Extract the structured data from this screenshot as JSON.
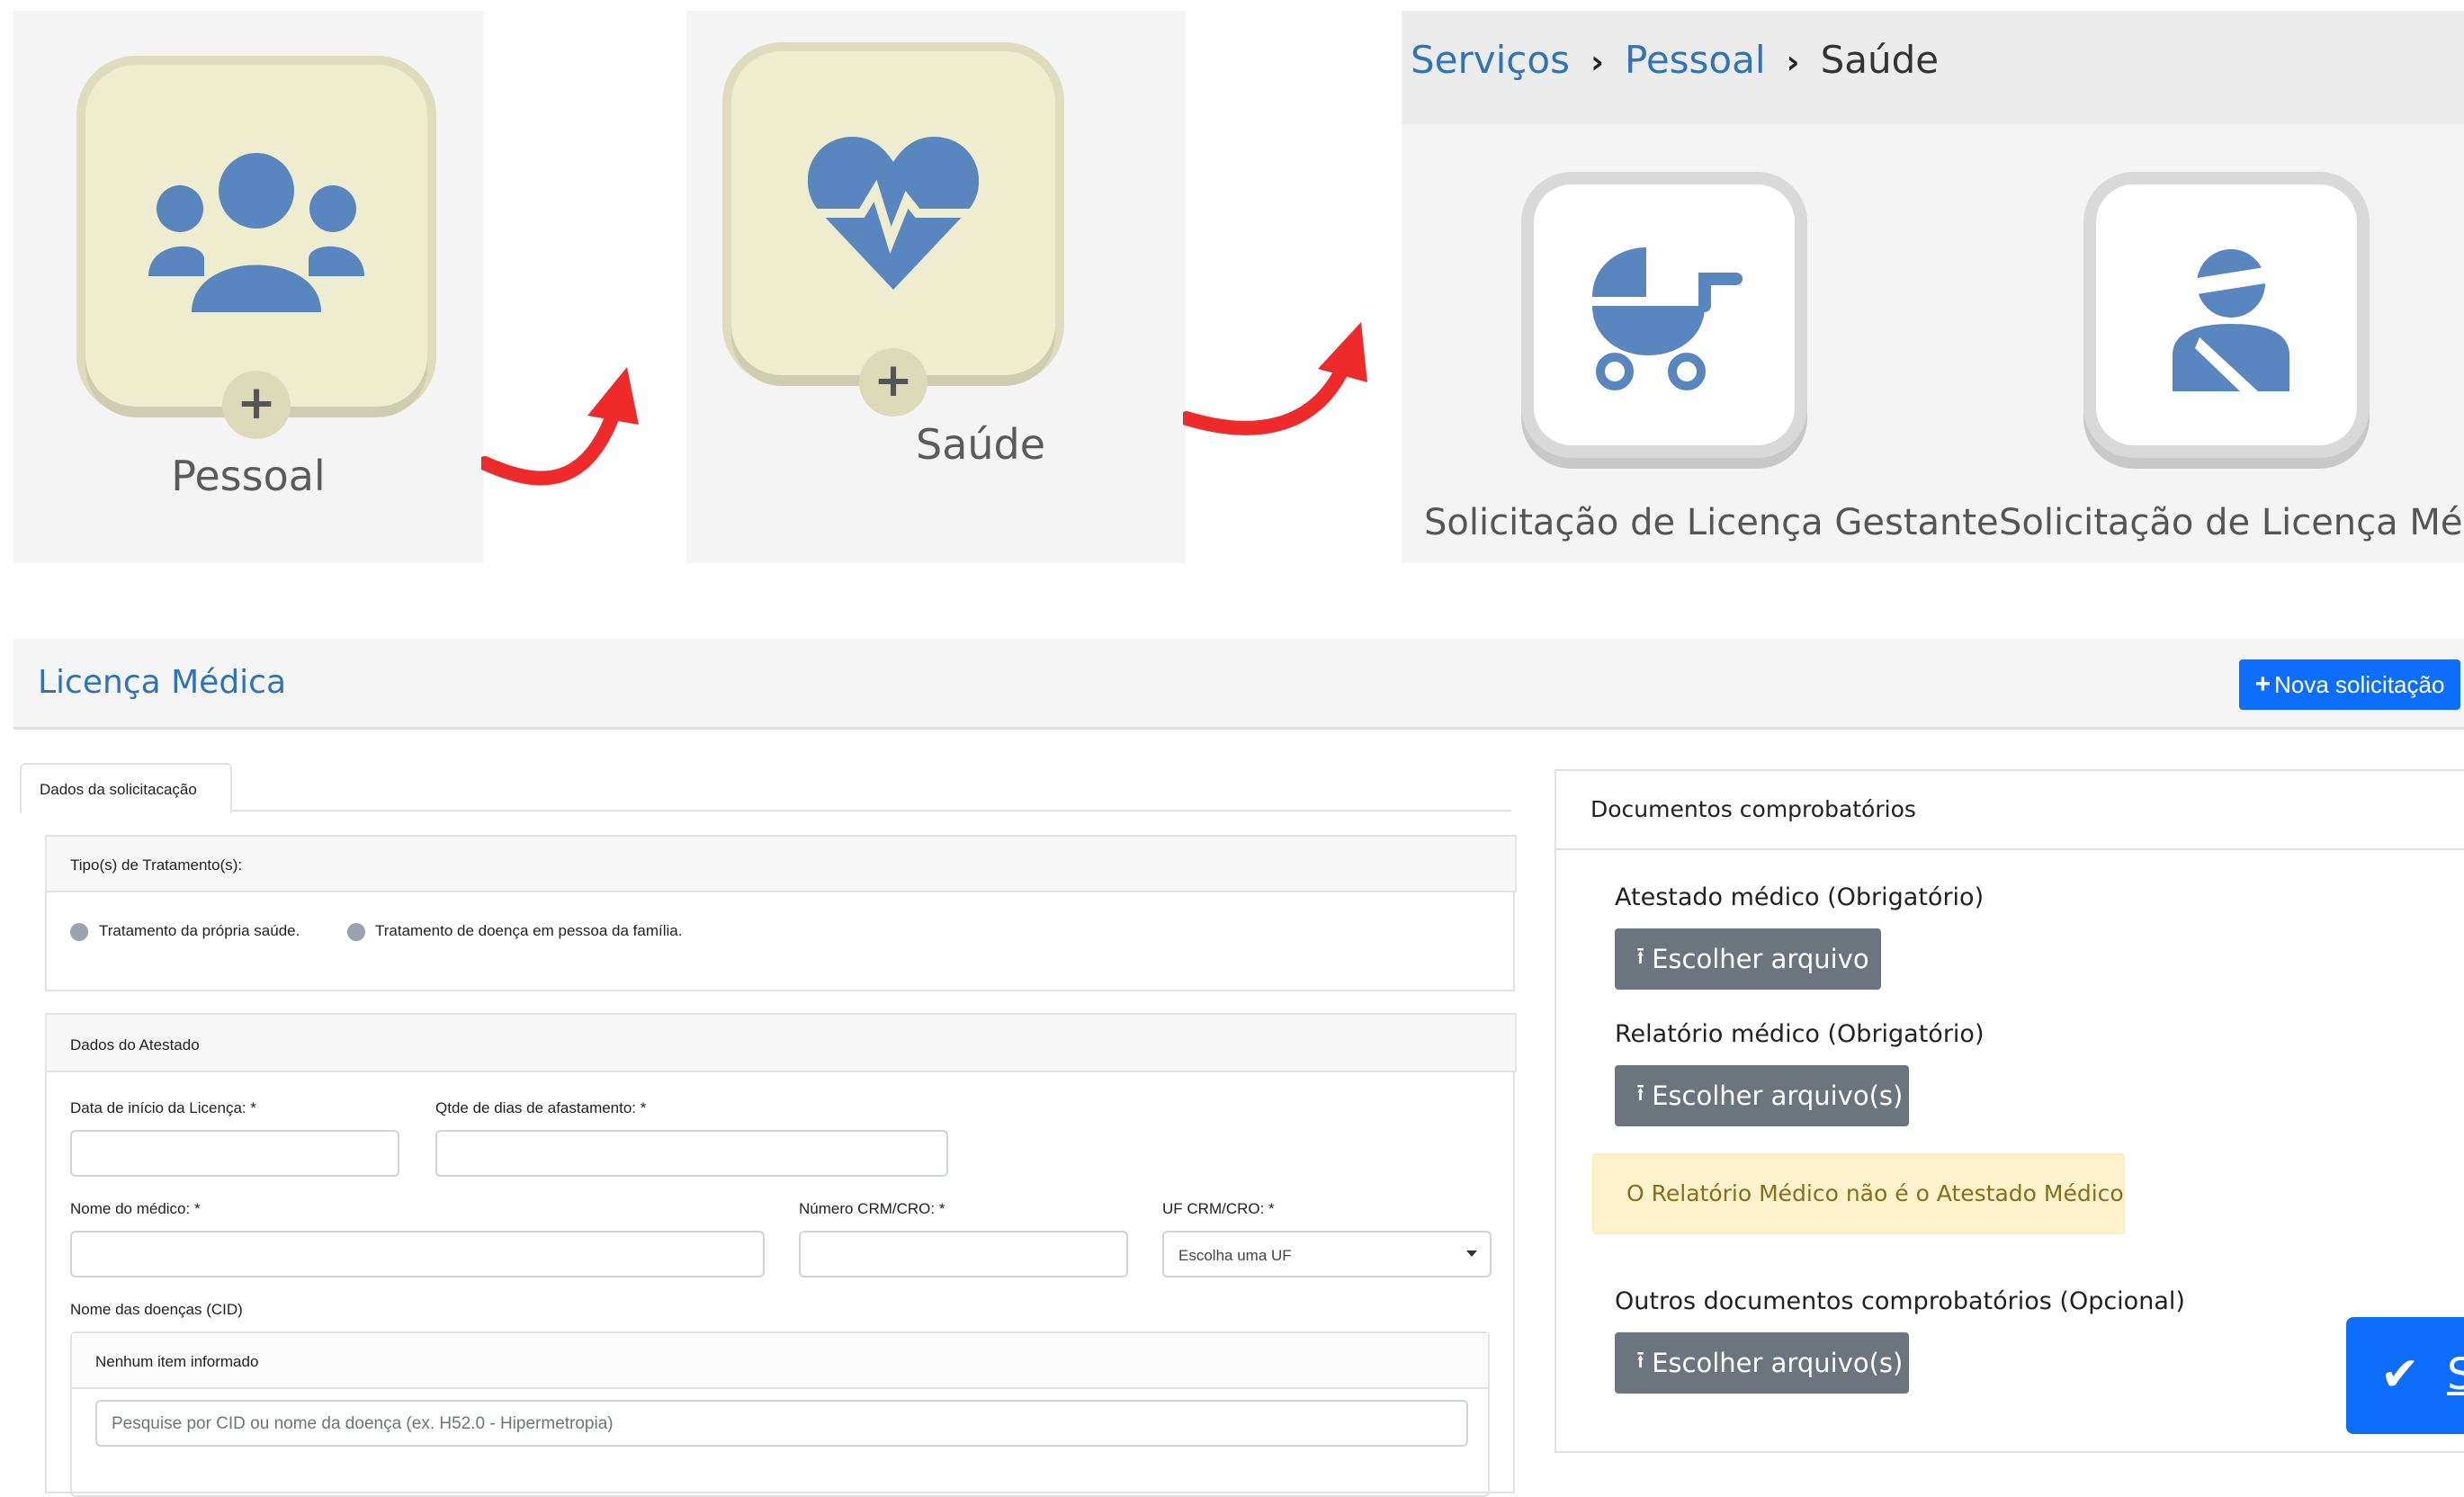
{
  "steps": {
    "pessoal": {
      "label": "Pessoal",
      "plus": "+"
    },
    "saude": {
      "label": "Saúde",
      "plus": "+"
    }
  },
  "breadcrumb": {
    "items": [
      "Serviços",
      "Pessoal",
      "Saúde"
    ],
    "separator": "›"
  },
  "services": [
    {
      "label": "Solicitação de Licença Gestante",
      "icon": "baby-carriage-icon"
    },
    {
      "label": "Solicitação de Licença Médica",
      "icon": "injured-person-icon"
    }
  ],
  "colors": {
    "icon_blue": "#5a86c0",
    "link_blue": "#2f73b8",
    "primary": "#0d6efd",
    "arrow_red": "#ef2a2a",
    "tile_bg": "#efedcf"
  },
  "form": {
    "title": "Licença Médica",
    "new_button": "Nova solicitação",
    "tab": "Dados da solicitacação",
    "treatment": {
      "heading": "Tipo(s) de Tratamento(s):",
      "options": [
        "Tratamento da própria saúde.",
        "Tratamento de doença em pessoa da família."
      ]
    },
    "atestado": {
      "heading": "Dados do Atestado",
      "start_date_label": "Data de início da Licença: *",
      "days_label": "Qtde de dias de afastamento: *",
      "doctor_label": "Nome do médico: *",
      "crm_label": "Número CRM/CRO: *",
      "uf_label": "UF CRM/CRO: *",
      "uf_select": "Escolha uma UF",
      "cid_label": "Nome das doenças (CID)",
      "cid_empty": "Nenhum item informado",
      "cid_placeholder": "Pesquise por CID ou nome da doença (ex. H52.0 - Hipermetropia)"
    }
  },
  "documents": {
    "heading": "Documentos comprobatórios",
    "atestado_label": "Atestado médico (Obrigatório)",
    "atestado_button": "Escolher arquivo",
    "relatorio_label": "Relatório médico (Obrigatório)",
    "relatorio_button": "Escolher arquivo(s)",
    "warning": "O Relatório Médico não é o Atestado Médico",
    "outros_label": "Outros documentos comprobatórios (Opcional)",
    "outros_button": "Escolher arquivo(s)"
  },
  "submit_partial": "S"
}
